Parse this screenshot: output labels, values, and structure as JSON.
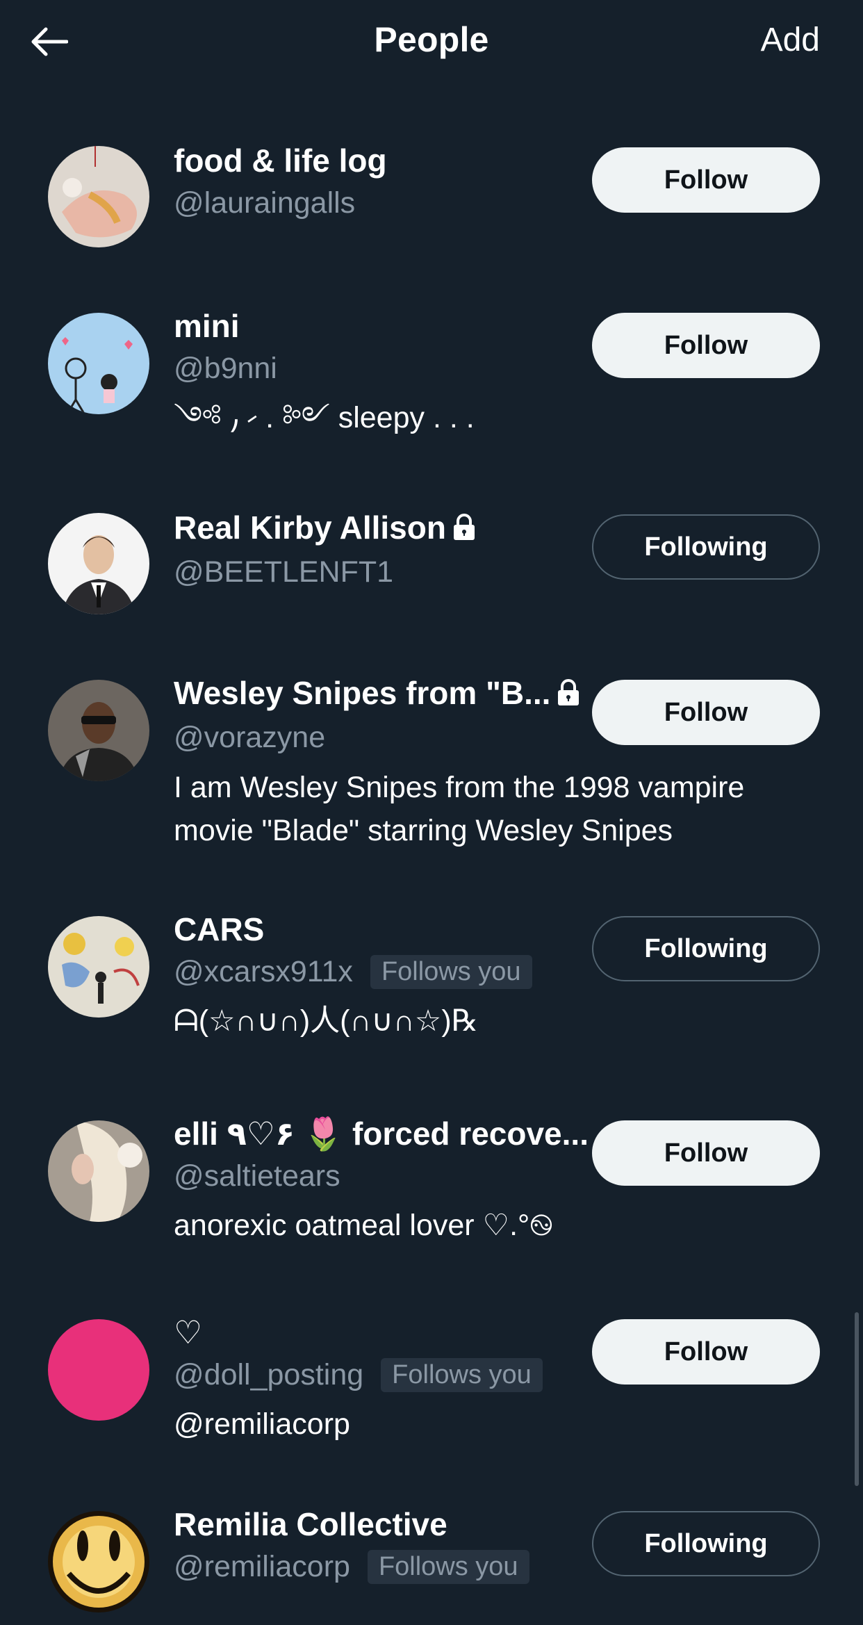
{
  "header": {
    "title": "People",
    "add_label": "Add"
  },
  "colors": {
    "background": "#15202b",
    "secondary_text": "#8b98a5",
    "follow_button_bg": "#eff3f4"
  },
  "people": [
    {
      "name": "food & life log",
      "handle": "@lauraingalls",
      "follows_you": "",
      "bio": "",
      "button": "Follow",
      "locked": false
    },
    {
      "name": "mini",
      "handle": "@b9nni",
      "follows_you": "",
      "bio": "༺ ⹜ ⹝ . ༻ sleepy . . .",
      "button": "Follow",
      "locked": false
    },
    {
      "name": "Real Kirby Allison",
      "handle": "@BEETLENFT1",
      "follows_you": "",
      "bio": "",
      "button": "Following",
      "locked": true
    },
    {
      "name": "Wesley Snipes from \"B...",
      "handle": "@vorazyne",
      "follows_you": "",
      "bio": "I am Wesley Snipes from the 1998 vampire movie \"Blade\" starring Wesley Snipes",
      "button": "Follow",
      "locked": true
    },
    {
      "name": "CARS",
      "handle": "@xcarsx911x",
      "follows_you": "Follows you",
      "bio": "ᗩ(☆∩∪∩)人(∩∪∩☆)℞",
      "button": "Following",
      "locked": false
    },
    {
      "name": "elli ٩♡۶ 🌷 forced recove...",
      "handle": "@saltietears",
      "follows_you": "",
      "bio": "anorexic oatmeal lover ♡.°࿊",
      "button": "Follow",
      "locked": false
    },
    {
      "name": "♡",
      "handle": "@doll_posting",
      "follows_you": "Follows you",
      "bio": "@remiliacorp",
      "button": "Follow",
      "locked": false
    },
    {
      "name": "Remilia Collective",
      "handle": "@remiliacorp",
      "follows_you": "Follows you",
      "bio": "",
      "button": "Following",
      "locked": false
    }
  ]
}
